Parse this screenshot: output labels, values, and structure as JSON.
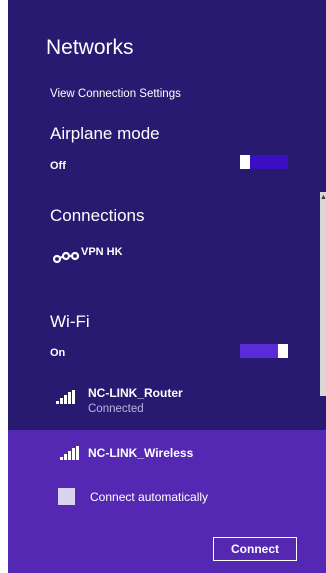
{
  "header": {
    "title": "Networks"
  },
  "view_settings_link": "View Connection Settings",
  "airplane": {
    "label": "Airplane mode",
    "state": "Off",
    "on": false
  },
  "connections": {
    "label": "Connections",
    "items": [
      {
        "name": "VPN HK",
        "icon": "vpn-icon"
      }
    ]
  },
  "wifi": {
    "label": "Wi-Fi",
    "state": "On",
    "on": true,
    "networks": [
      {
        "name": "NC-LINK_Router",
        "status": "Connected",
        "icon": "wifi-signal-icon"
      },
      {
        "name": "NC-LINK_Wireless",
        "icon": "wifi-signal-icon"
      }
    ]
  },
  "selected_network": {
    "connect_automatically_label": "Connect automatically",
    "connect_automatically_checked": false,
    "connect_button": "Connect"
  },
  "colors": {
    "panel_background": "#281a70",
    "selected_background": "#5428b3",
    "toggle_off_track": "#3a0fc4",
    "toggle_on_track": "#5a2bd8"
  }
}
